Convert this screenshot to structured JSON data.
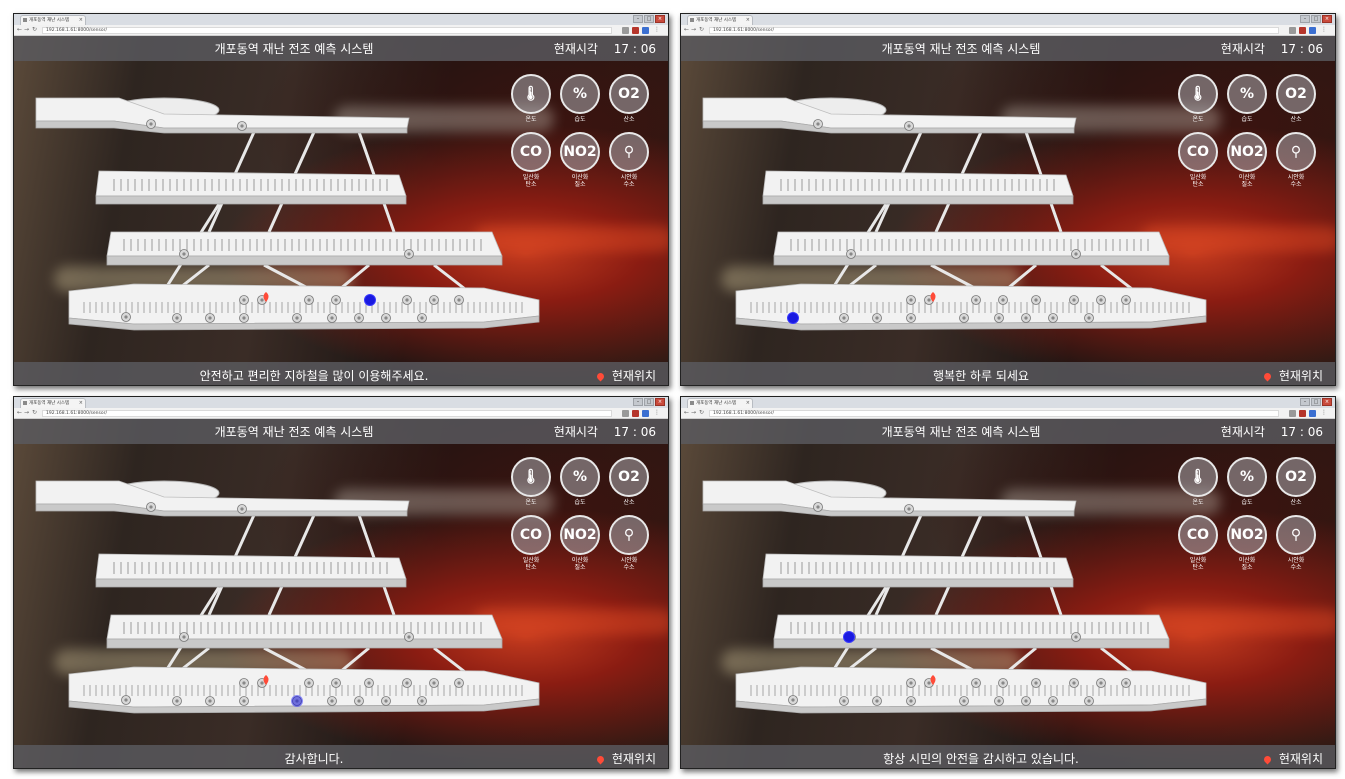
{
  "panels": [
    {
      "browser": {
        "tab_title": "개포동역 재난 시스템",
        "url": "192.168.1.61:8000/sensor/"
      },
      "header": {
        "title": "개포동역 재난 전조 예측 시스템",
        "clock_label": "현재시각",
        "clock_time": "17 : 06"
      },
      "footer": {
        "message": "안전하고 편리한 지하철을 많이 이용해주세요.",
        "location_label": "현재위치"
      }
    },
    {
      "browser": {
        "tab_title": "개포동역 재난 시스템",
        "url": "192.168.1.61:8000/sensor/"
      },
      "header": {
        "title": "개포동역 재난 전조 예측 시스템",
        "clock_label": "현재시각",
        "clock_time": "17 : 06"
      },
      "footer": {
        "message": "행복한 하루 되세요",
        "location_label": "현재위치"
      }
    },
    {
      "browser": {
        "tab_title": "개포동역 재난 시스템",
        "url": "192.168.1.61:8000/sensor/"
      },
      "header": {
        "title": "개포동역 재난 전조 예측 시스템",
        "clock_label": "현재시각",
        "clock_time": "17 : 06"
      },
      "footer": {
        "message": "감사합니다.",
        "location_label": "현재위치"
      }
    },
    {
      "browser": {
        "tab_title": "개포동역 재난 시스템",
        "url": "192.168.1.61:8000/sensor/"
      },
      "header": {
        "title": "개포동역 재난 전조 예측 시스템",
        "clock_label": "현재시각",
        "clock_time": "17 : 06"
      },
      "footer": {
        "message": "항상 시민의 안전을 감시하고 있습니다.",
        "location_label": "현재위치"
      }
    }
  ],
  "sensors": [
    {
      "name": "thermometer-icon",
      "glyph": "🌡",
      "label": "온도"
    },
    {
      "name": "humidity-icon",
      "glyph": "%",
      "label": "습도"
    },
    {
      "name": "oxygen-icon",
      "glyph": "O2",
      "label": "산소"
    },
    {
      "name": "co-icon",
      "glyph": "CO",
      "label": "일산화\n탄소"
    },
    {
      "name": "no2-icon",
      "glyph": "NO2",
      "label": "이산화\n질소"
    },
    {
      "name": "hcn-icon",
      "glyph": "⚲",
      "label": "시안화\n수소"
    }
  ],
  "colors": {
    "header_bg": "#5a5a5f",
    "marker_blue": "#1a1ae0",
    "pin_red": "#ff4b38"
  },
  "blue_marker_floor": [
    "platform",
    "platform",
    "platform",
    "concourse"
  ]
}
